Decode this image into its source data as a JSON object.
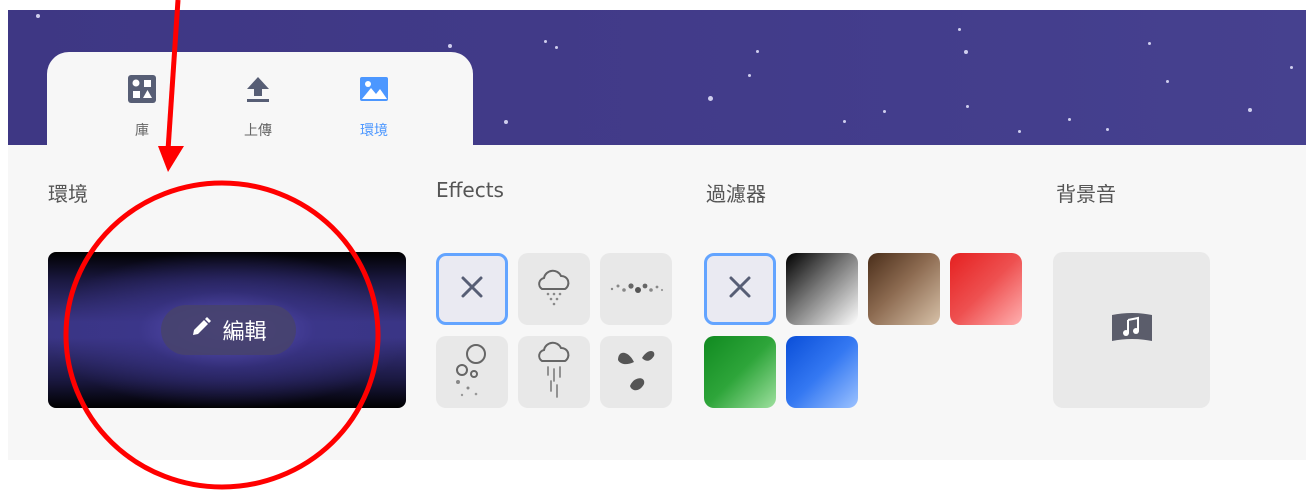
{
  "tabs": [
    {
      "label": "庫",
      "icon": "library-icon",
      "active": false
    },
    {
      "label": "上傳",
      "icon": "upload-icon",
      "active": false
    },
    {
      "label": "環境",
      "icon": "environment-icon",
      "active": true
    }
  ],
  "sections": {
    "environment": {
      "title": "環境",
      "edit_label": "編輯"
    },
    "effects": {
      "title": "Effects",
      "items": [
        "none-icon",
        "cloud-snow-icon",
        "dots-icon",
        "bubbles-icon",
        "cloud-rain-icon",
        "leaves-icon"
      ]
    },
    "filters": {
      "title": "過濾器",
      "items": [
        {
          "name": "none-icon"
        },
        {
          "name": "grayscale-swatch",
          "color": "#7f7f7f"
        },
        {
          "name": "sepia-swatch",
          "color": "#9b7a5e"
        },
        {
          "name": "red-swatch",
          "color": "#e84646"
        },
        {
          "name": "green-swatch",
          "color": "#2ea53a"
        },
        {
          "name": "blue-swatch",
          "color": "#3478f2"
        }
      ]
    },
    "music": {
      "title": "背景音",
      "icon": "music-icon"
    }
  },
  "colors": {
    "accent": "#4c97ff",
    "annotation": "#ff0000",
    "hero": "#413a88"
  }
}
